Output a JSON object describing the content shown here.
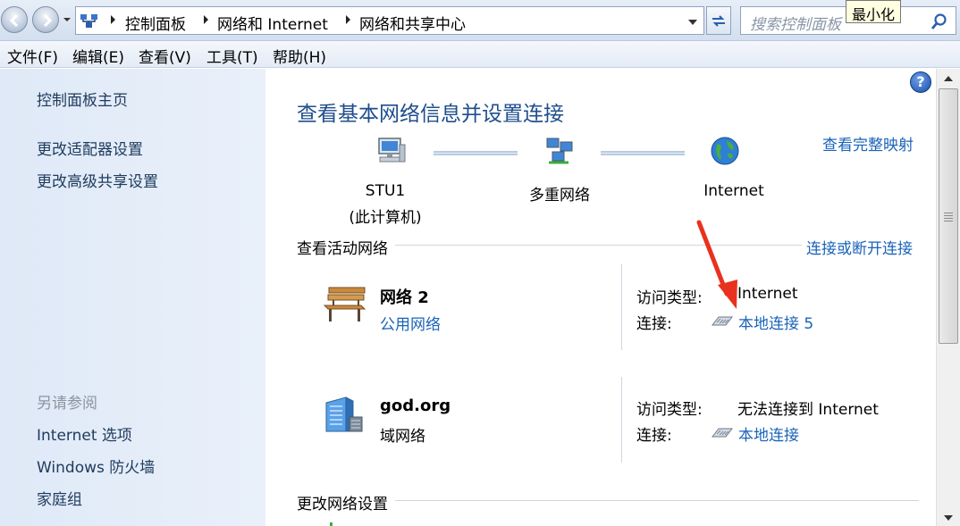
{
  "tooltip": "最小化",
  "address": {
    "crumbs": [
      "控制面板",
      "网络和 Internet",
      "网络和共享中心"
    ]
  },
  "search": {
    "placeholder": "搜索控制面板"
  },
  "menu": [
    "文件(F)",
    "编辑(E)",
    "查看(V)",
    "工具(T)",
    "帮助(H)"
  ],
  "sidebar": {
    "home": "控制面板主页",
    "links": [
      "更改适配器设置",
      "更改高级共享设置"
    ],
    "see_also_heading": "另请参阅",
    "see_also": [
      "Internet 选项",
      "Windows 防火墙",
      "家庭组"
    ]
  },
  "main": {
    "title": "查看基本网络信息并设置连接",
    "full_map": "查看完整映射",
    "map": {
      "computer_name": "STU1",
      "computer_sub": "(此计算机)",
      "middle": "多重网络",
      "internet": "Internet"
    },
    "active_section": "查看活动网络",
    "connect_link": "连接或断开连接",
    "networks": [
      {
        "name": "网络  2",
        "type": "公用网络",
        "access_label": "访问类型:",
        "access_value": "Internet",
        "conn_label": "连接:",
        "conn_value": "本地连接 5",
        "icon": "park-bench-icon"
      },
      {
        "name": "god.org",
        "type": "域网络",
        "access_label": "访问类型:",
        "access_value": "无法连接到 Internet",
        "conn_label": "连接:",
        "conn_value": "本地连接",
        "icon": "domain-building-icon"
      }
    ],
    "change_section": "更改网络设置"
  },
  "colors": {
    "link": "#1a63b8",
    "title": "#1e4e8c",
    "sidebar_bg": "#dfe9f7",
    "annotation_arrow": "#e8321e"
  }
}
